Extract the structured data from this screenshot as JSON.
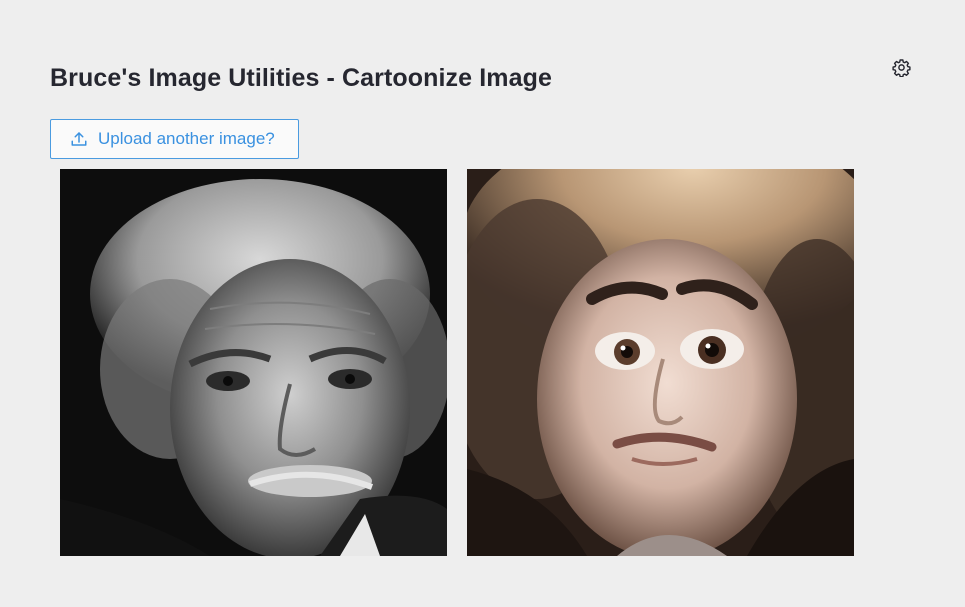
{
  "header": {
    "title": "Bruce's Image Utilities - Cartoonize Image",
    "settings_icon": "gear-icon"
  },
  "upload": {
    "label": "Upload another image?",
    "icon": "upload-icon",
    "accent_color": "#3a91e0"
  },
  "images": [
    {
      "role": "original",
      "description_icon": "photo-original"
    },
    {
      "role": "cartoonized",
      "description_icon": "photo-cartoonized"
    }
  ],
  "colors": {
    "background": "#eeeeee",
    "title": "#262730",
    "button_border": "#4a9be0"
  }
}
